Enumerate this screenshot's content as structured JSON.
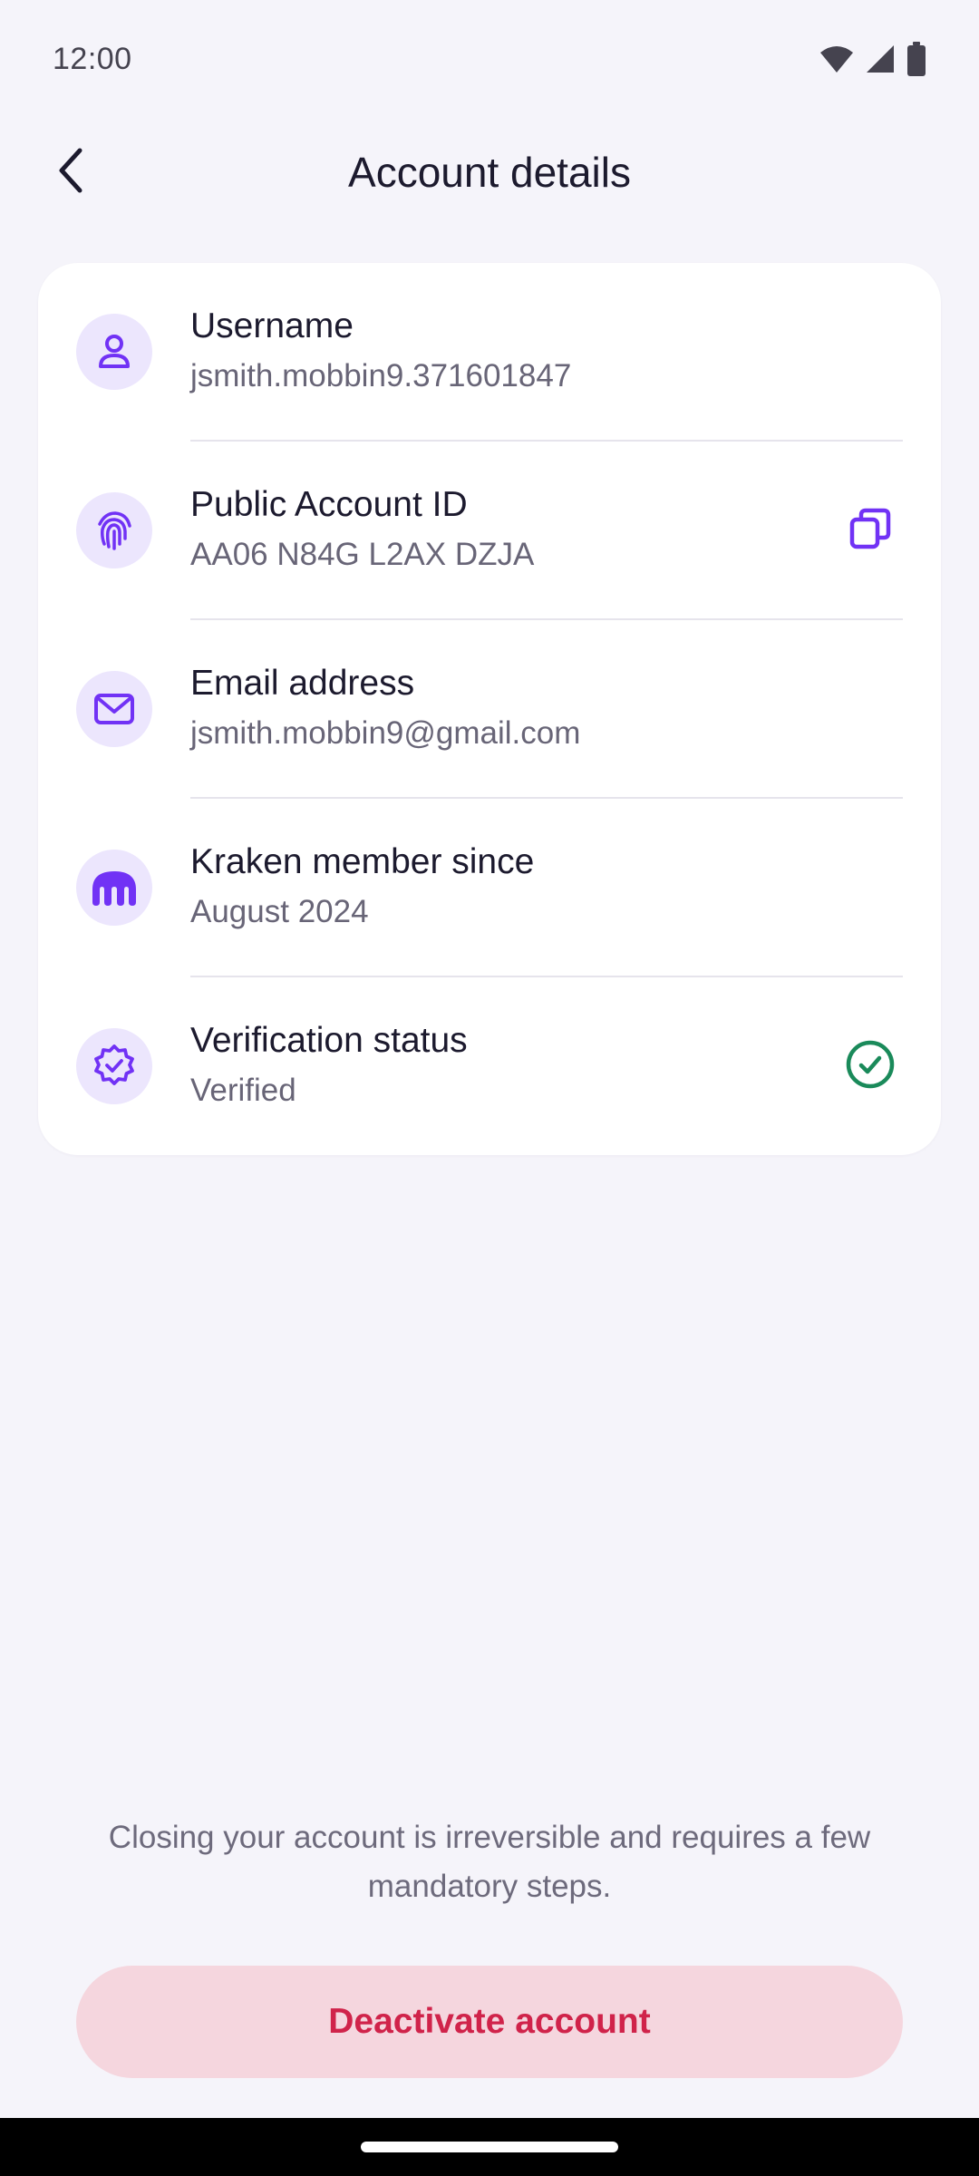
{
  "status_bar": {
    "time": "12:00",
    "icons": [
      "wifi-icon",
      "cell-signal-icon",
      "battery-icon"
    ]
  },
  "app_bar": {
    "back_icon": "chevron-left-icon",
    "title": "Account details"
  },
  "details": {
    "rows": [
      {
        "label": "Username",
        "value": "jsmith.mobbin9.371601847",
        "icon": "user-icon"
      },
      {
        "label": "Public Account ID",
        "value": "AA06 N84G L2AX DZJA",
        "icon": "fingerprint-icon",
        "action_icon": "copy-icon"
      },
      {
        "label": "Email address",
        "value": "jsmith.mobbin9@gmail.com",
        "icon": "mail-icon"
      },
      {
        "label": "Kraken member since",
        "value": "August 2024",
        "icon": "kraken-logo-icon"
      },
      {
        "label": "Verification status",
        "value": "Verified",
        "icon": "verified-badge-icon",
        "status_icon": "check-circle-icon"
      }
    ]
  },
  "footer": {
    "closing_note": "Closing your account is irreversible and requires a few mandatory steps.",
    "deactivate_label": "Deactivate account"
  },
  "colors": {
    "background": "#f5f4fa",
    "card": "#ffffff",
    "accent_purple": "#7132f5",
    "icon_circle": "#ece6fd",
    "verified_green": "#1a8a5a",
    "danger_text": "#d0234a",
    "danger_bg": "#f5d6de"
  }
}
